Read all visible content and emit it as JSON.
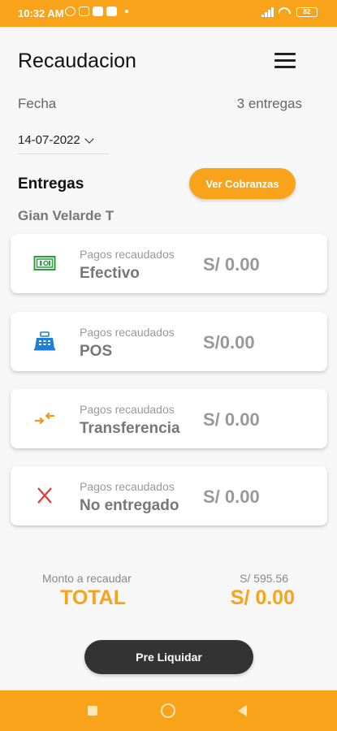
{
  "status": {
    "time": "10:32 AM",
    "battery": "82"
  },
  "header": {
    "title": "Recaudacion"
  },
  "filter": {
    "date_label": "Fecha",
    "deliveries_count": "3 entregas",
    "date_value": "14-07-2022"
  },
  "entregas": {
    "title": "Entregas",
    "button_label": "Ver Cobranzas",
    "collector": "Gian Velarde T"
  },
  "payments": [
    {
      "subtitle": "Pagos recaudados",
      "name": "Efectivo",
      "amount": "S/ 0.00",
      "icon": "cash-icon",
      "icon_color": "#2e9e3f"
    },
    {
      "subtitle": "Pagos recaudados",
      "name": "POS",
      "amount": "S/0.00",
      "icon": "pos-terminal-icon",
      "icon_color": "#1f7fd6"
    },
    {
      "subtitle": "Pagos recaudados",
      "name": "Transferencia",
      "amount": "S/ 0.00",
      "icon": "transfer-arrows-icon",
      "icon_color": "#f39a1e"
    },
    {
      "subtitle": "Pagos recaudados",
      "name": "No entregado",
      "amount": "S/ 0.00",
      "icon": "close-x-icon",
      "icon_color": "#e53935"
    }
  ],
  "summary": {
    "monto_label": "Monto a recaudar",
    "monto_value": "S/ 595.56",
    "total_label": "TOTAL",
    "total_value": "S/ 0.00"
  },
  "actions": {
    "preliquidar_label": "Pre Liquidar"
  },
  "colors": {
    "accent": "#f9a31a",
    "dark_button": "#333333"
  }
}
